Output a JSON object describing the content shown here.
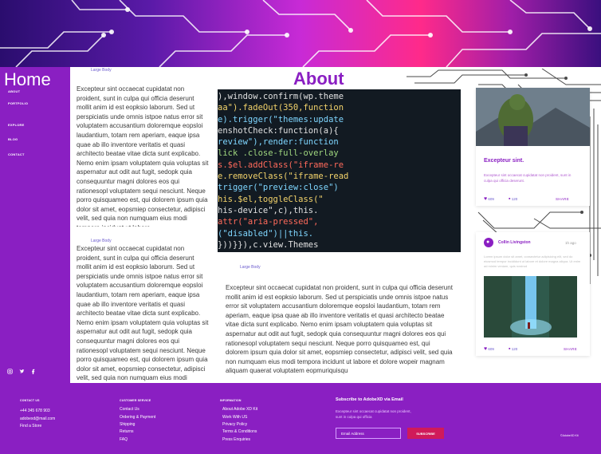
{
  "sidebar": {
    "brand": "Home",
    "nav": [
      "ABOUT",
      "PORTFOLIO",
      "EXPLORE",
      "BLOG",
      "CONTACT"
    ],
    "social_icons": [
      "instagram-icon",
      "twitter-icon",
      "facebook-icon"
    ]
  },
  "about": {
    "title": "About",
    "label_1": "Large Body",
    "label_2": "Large Body",
    "label_3": "Large Body",
    "paragraph": "Excepteur sint occaecat cupidatat non proident, sunt in culpa qui officia deserunt mollit anim id est eopksio laborum. Sed ut perspiciatis unde omnis istpoe natus error sit voluptatem accusantium doloremque eopsloi laudantium, totam rem aperiam, eaque ipsa quae ab illo inventore veritatis et quasi architecto beatae vitae dicta sunt explicabo. Nemo enim ipsam voluptatem quia voluptas sit aspernatur aut odit aut fugit, sedopk quia consequuntur magni dolores eos qui rationesopl voluptatem sequi nesciunt. Neque porro quisquameo est, qui dolorem ipsum quia dolor sit amet, eopsmiep consectetur, adipisci velit, sed quia non numquam eius modi tempora incidunt ut labore",
    "paragraph_wide": "Excepteur sint occaecat cupidatat non proident, sunt in culpa qui officia deserunt mollit anim id est eopksio laborum. Sed ut perspiciatis unde omnis istpoe natus error sit voluptatem accusantium doloremque eopsloi laudantium, totam rem aperiam, eaque ipsa quae ab illo inventore veritatis et quasi architecto beatae vitae dicta sunt explicabo. Nemo enim ipsam voluptatem quia voluptas sit aspernatur aut odit aut fugit, sedopk quia consequuntur magni dolores eos qui rationesopl voluptatem sequi nesciunt. Neque porro quisquameo est, qui dolorem ipsum quia dolor sit amet, eopsmiep consectetur, adipisci velit, sed quia non numquam eius modi tempora incidunt ut labore et dolore wopeir magnam aliquam quaerat voluptatem eopmuriquisqu"
  },
  "card1": {
    "title": "Excepteur sint.",
    "desc": "Excepteur sint occaecat cupidatat non proident, sunt in culpa qui officia deserunt.",
    "likes": "609",
    "comments": "120",
    "share": "SHARE"
  },
  "card2": {
    "author": "Collin Livingston",
    "time": "1h ago",
    "desc": "Lorem ipsum dolor sit amet, consectetur adipisicing elit, sed do eiusmod tempor incididunt ut labore et dolore magna aliqua. Ut enim ad minim veniam, quis nostrud",
    "likes": "609",
    "comments": "120",
    "share": "SHARE"
  },
  "code_lines": [
    "),window.confirm(wp.theme",
    "aa\").fadeOut(350,function",
    "e).trigger(\"themes:update",
    "enshotCheck:function(a){",
    "review\"),render:function",
    "lick .close-full-overlay",
    "s.$el.addClass(\"iframe-re",
    "e.removeClass(\"iframe-read",
    "trigger(\"preview:close\")",
    "his.$el,toggleClass(\"",
    "his-device\",c),this.",
    "attr(\"aria-pressed\",",
    "(\"disabled\")||this.",
    "}))}}),c.view.Themes"
  ],
  "footer": {
    "contact_head": "CONTACT US",
    "phone": "+44 345 678 903",
    "email": "adobexd@mail.com",
    "find_store": "Find a Store",
    "service_head": "CUSTOMER SERVICE",
    "service_items": [
      "Contact Us",
      "Ordering & Payment",
      "Shipping",
      "Returns",
      "FAQ"
    ],
    "info_head": "INFORMATION",
    "info_items": [
      "About Adobe XD Kit",
      "Work With US",
      "Privacy Policy",
      "Terms & Conditions",
      "Press Enquiries"
    ],
    "subscribe_title": "Subscribe to AdobeXD via Email",
    "subscribe_desc": "Excepteur sint occaecat cupidatat non proident, sunt in culpa qui officia",
    "email_placeholder": "Email Address",
    "subscribe_button": "SUBSCRIBE",
    "copyright": "©AdobeXD Kit"
  },
  "colors": {
    "primary": "#8a1fc2",
    "accent": "#d01a5a"
  }
}
